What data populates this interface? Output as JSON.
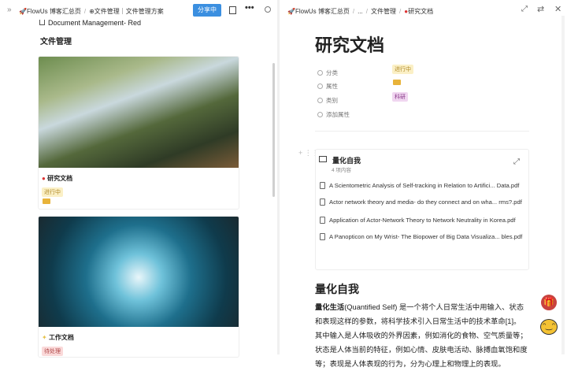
{
  "left": {
    "breadcrumb": [
      "FlowUs 博客汇总页",
      "⊕文件管理｜文件管理方案"
    ],
    "share_label": "分享中",
    "subtitle": "Document Management- Red",
    "section_title": "文件管理",
    "cards": [
      {
        "title": "研究文档",
        "tag": "进行中",
        "icon": "balloon-icon"
      },
      {
        "title": "工作文档",
        "tag": "待处理",
        "icon": "sparkle-icon"
      }
    ]
  },
  "right": {
    "breadcrumb": [
      "FlowUs 博客汇总页",
      "...",
      "文件管理",
      "研究文档"
    ],
    "title": "研究文档",
    "properties": [
      {
        "label": "分类",
        "value": "进行中"
      },
      {
        "label": "属性",
        "value": ""
      },
      {
        "label": "类别",
        "value": "科研"
      },
      {
        "label": "添加属性",
        "value": ""
      }
    ],
    "folder_block": {
      "title": "量化自我",
      "subtitle": "4 项内容",
      "files": [
        "A Scientometric Analysis of Self-tracking in Relation to Artifici... Data.pdf",
        "Actor network theory and media- do they connect and on wha... rms?.pdf",
        "Application of Actor-Network Theory to Network Neutrality in Korea.pdf",
        "A Panopticon on My Wrist- The Biopower of Big Data Visualiza... bles.pdf"
      ]
    },
    "heading": "量化自我",
    "para_bold": "量化生活",
    "para_rest": "(Quantified Self) 是一个将个人日常生活中用输入、状态和表现这样的参数，将科学技术引入日常生活中的技术革命[1]。其中输入是人体吸收的外界因素，例如消化的食物、空气质量等；状态是人体当前的特征，例如心情、皮肤电活动、脉搏血氧饱和度等；表现是人体表现的行为，分为心理上和物理上的表现。"
  },
  "colors": {
    "accent": "#3b8fe0",
    "tag_progress": "#fbf0c6",
    "tag_research": "#f0d6f0",
    "tag_pending": "#fad9d9"
  }
}
